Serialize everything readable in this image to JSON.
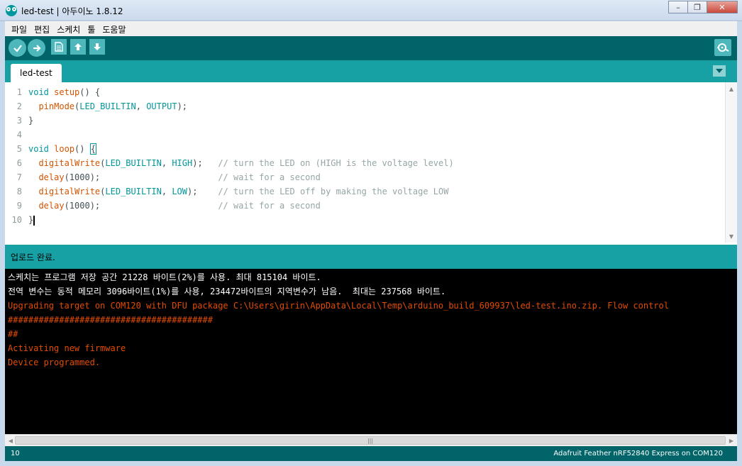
{
  "window": {
    "title": "led-test | 아두이노 1.8.12",
    "minimize": "–",
    "restore": "❐",
    "close": "✕"
  },
  "menu": [
    "파일",
    "편집",
    "스케치",
    "툴",
    "도움말"
  ],
  "tabs": [
    {
      "label": "led-test"
    }
  ],
  "editor": {
    "line_numbers": [
      "1",
      "2",
      "3",
      "4",
      "5",
      "6",
      "7",
      "8",
      "9",
      "10"
    ]
  },
  "status": {
    "message": "업로드 완료."
  },
  "console": {
    "white_lines": [
      "스케치는 프로그램 저장 공간 21228 바이트(2%)를 사용. 최대 815104 바이트.",
      "전역 변수는 동적 메모리 3096바이트(1%)를 사용, 234472바이트의 지역변수가 남음.  최대는 237568 바이트."
    ],
    "orange_lines": [
      "Upgrading target on COM120 with DFU package C:\\Users\\girin\\AppData\\Local\\Temp\\arduino_build_609937\\led-test.ino.zip. Flow control",
      "########################################",
      "##",
      "Activating new firmware",
      "Device programmed."
    ]
  },
  "footer": {
    "line": "10",
    "board": "Adafruit Feather nRF52840 Express on COM120"
  },
  "colors": {
    "teal_dark": "#006468",
    "teal": "#17a1a5",
    "console_error": "#e34c00"
  }
}
